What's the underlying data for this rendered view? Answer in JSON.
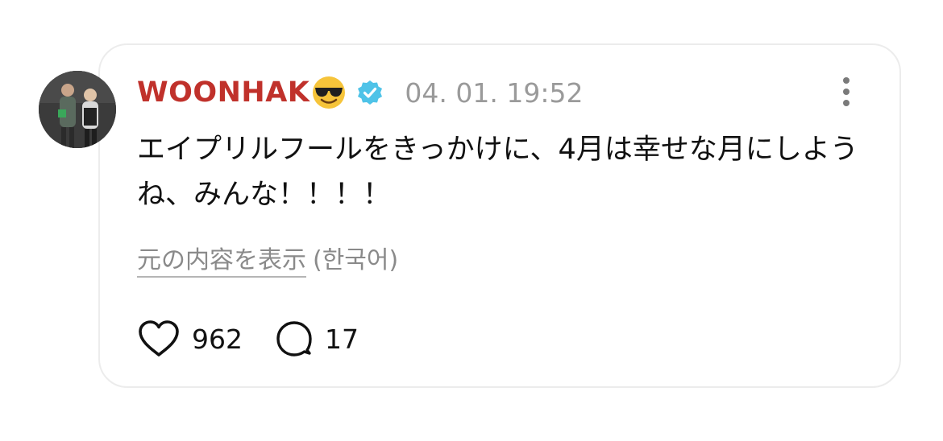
{
  "post": {
    "username": "WOONHAK",
    "username_color": "#c0312b",
    "emoji": "smiling-face-with-sunglasses",
    "verified_icon": "verified-badge-icon",
    "verified_color": "#4fc3e8",
    "timestamp": "04. 01. 19:52",
    "text": "エイプリルフールをきっかけに、4月は幸せな月にしようね、みんな！！！！",
    "translation_link": "元の内容を表示",
    "translation_lang": "(한국어)",
    "likes": "962",
    "replies": "17"
  },
  "icons": {
    "more": "more-vertical-icon",
    "like": "heart-icon",
    "reply": "speech-bubble-icon"
  }
}
